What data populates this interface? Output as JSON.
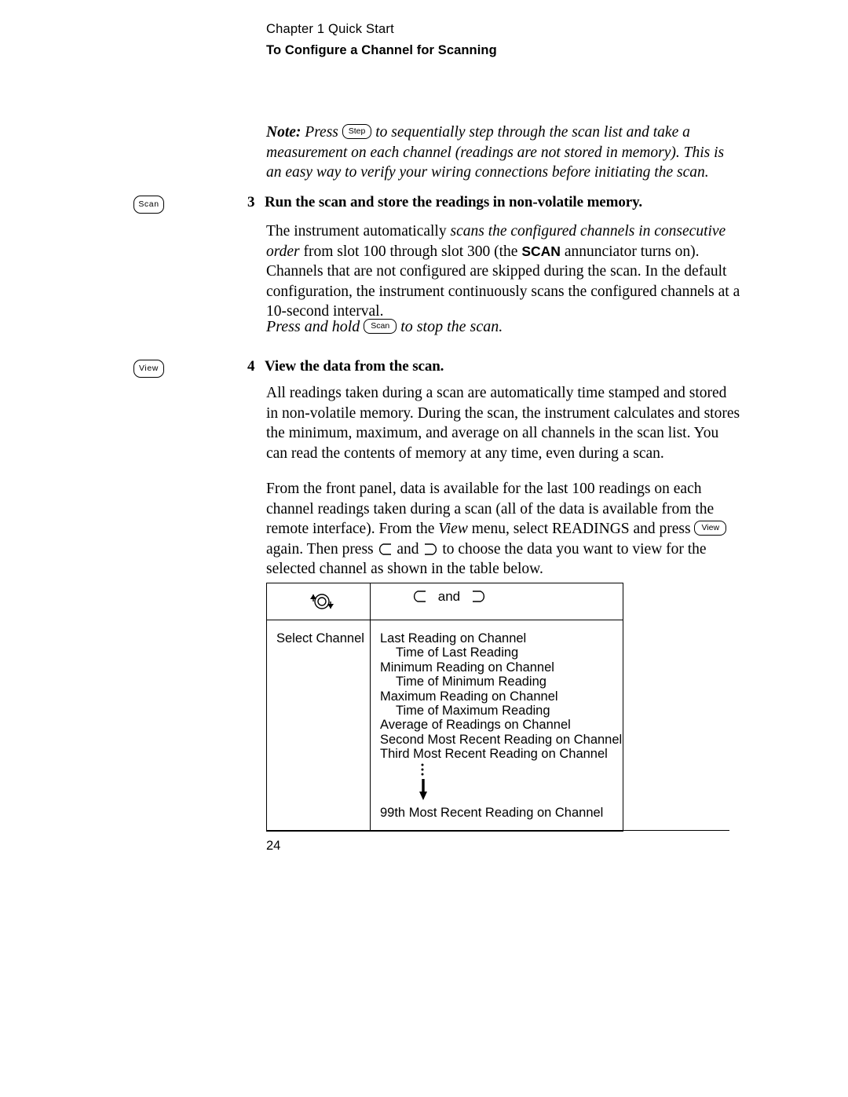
{
  "header": {
    "chapter": "Chapter 1  Quick Start",
    "title": "To Configure a Channel for Scanning"
  },
  "note": {
    "label": "Note:",
    "text_before_key": " Press ",
    "key_label": "Step",
    "text_after_key": " to sequentially step through the scan list and take a measurement on each channel (readings are not stored in memory). This is an easy way to verify your wiring connections before initiating the scan."
  },
  "steps": [
    {
      "number": "3",
      "heading": "Run the scan and store the readings in non-volatile memory.",
      "margin_key": "Scan",
      "body_1": "The instrument automatically ",
      "body_1_italic": "scans the configured channels in consecutive order",
      "body_2": " from slot 100 through slot 300 (the ",
      "body_bold": "SCAN",
      "body_3": " annunciator turns on). Channels that are not configured are skipped during the scan. In the default configuration, the instrument continuously scans the configured channels at a 10-second interval.",
      "emphasis_before": "Press and hold ",
      "emphasis_key": "Scan",
      "emphasis_after": " to stop the scan."
    },
    {
      "number": "4",
      "heading": "View the data from the scan.",
      "margin_key": "View",
      "body_1": "All readings taken during a scan are automatically time stamped and stored in non-volatile memory. During the scan, the instrument calculates and stores the minimum, maximum, and average on all channels in the scan list. You can read the contents of memory at any time, even during a scan.",
      "body_2_a": "From the front panel, data is available for the last 100 readings on each channel readings taken during a scan (all of the data is available from the remote interface). From the ",
      "body_2_italic": "View",
      "body_2_b": " menu, select READINGS and press ",
      "body_2_key": "View",
      "body_2_c": " again. Then press ",
      "body_2_d": " and ",
      "body_2_e": " to choose the data you want to view for the selected channel as shown in the table below."
    }
  ],
  "table": {
    "head_left_icon": "rotary-knob-icon",
    "head_right_text": "and",
    "col1_label": "Select Channel",
    "rows": [
      {
        "text": "Last Reading on Channel",
        "indent": false
      },
      {
        "text": "Time of Last Reading",
        "indent": true
      },
      {
        "text": "Minimum Reading on Channel",
        "indent": false
      },
      {
        "text": "Time of Minimum Reading",
        "indent": true
      },
      {
        "text": "Maximum Reading on Channel",
        "indent": false
      },
      {
        "text": "Time of Maximum Reading",
        "indent": true
      },
      {
        "text": "Average of Readings on Channel",
        "indent": false
      },
      {
        "text": "Second Most Recent Reading on Channel",
        "indent": false
      },
      {
        "text": "Third Most Recent Reading on Channel",
        "indent": false
      }
    ],
    "last_row": "99th Most Recent Reading on Channel"
  },
  "footer": {
    "page_number": "24"
  }
}
